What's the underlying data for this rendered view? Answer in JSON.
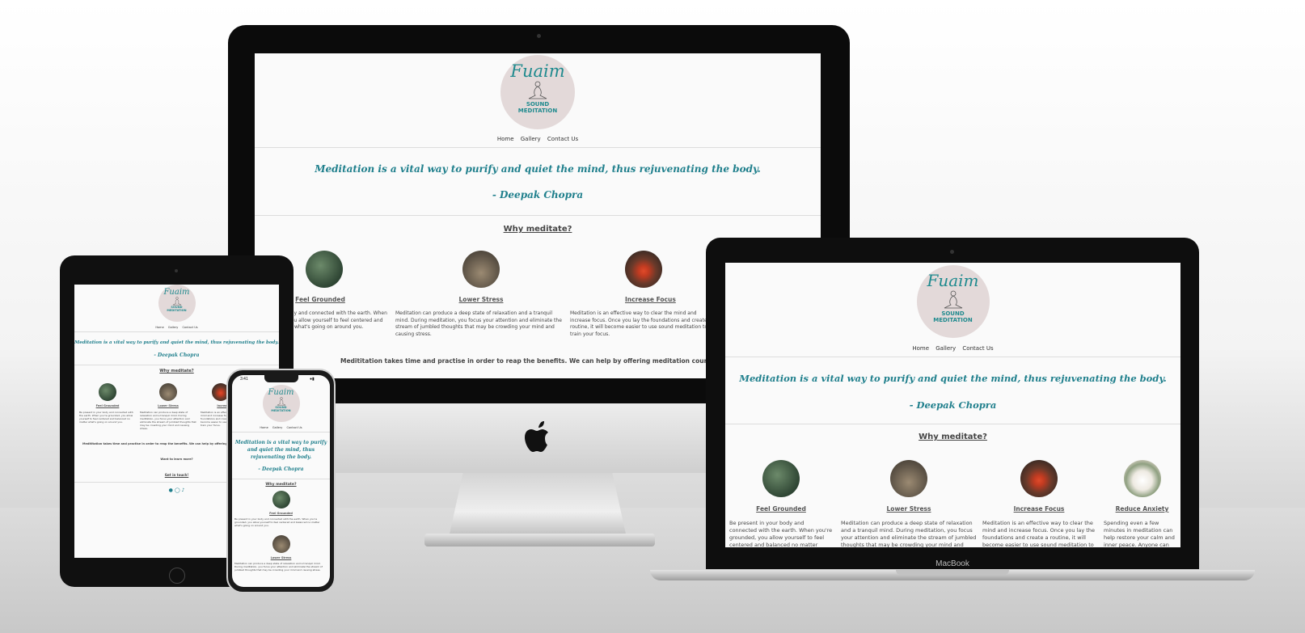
{
  "site": {
    "logo": {
      "script": "Fuaim",
      "line1": "SOUND",
      "line2": "MEDITATION"
    },
    "nav": [
      "Home",
      "Gallery",
      "Contact Us"
    ],
    "quote": "Meditation is a vital way to purify and quiet the mind, thus rejuvenating the body.",
    "author": "- Deepak Chopra",
    "why_heading": "Why meditate?",
    "features": [
      {
        "title": "Feel Grounded",
        "text": "Be present in your body and connected with the earth. When you're grounded, you allow yourself to feel centered and balanced no matter what's going on around you."
      },
      {
        "title": "Lower Stress",
        "text": "Meditation can produce a deep state of relaxation and a tranquil mind. During meditation, you focus your attention and eliminate the stream of jumbled thoughts that may be crowding your mind and causing stress."
      },
      {
        "title": "Increase Focus",
        "text": "Meditation is an effective way to clear the mind and increase focus. Once you lay the foundations and create a routine, it will become easier to use sound meditation to train your focus."
      },
      {
        "title": "Reduce Anxiety",
        "text": "Spending even a few minutes in meditation can help restore your calm and inner peace. Anyone can practice"
      }
    ],
    "benefits_text": "Medititation takes time and practise in order to reap the benefits. We can help by offering meditation courses, retreats and",
    "want_more": "Want to learn more?",
    "get_in_touch": "Get in touch!",
    "social_icons": [
      "facebook-icon",
      "instagram-icon",
      "tiktok-icon"
    ]
  },
  "devices": {
    "macbook_label": "MacBook",
    "phone_time": "3:41",
    "phone_status": "wifi battery"
  },
  "colors": {
    "accent": "#1f8a8e",
    "quote": "#1f7f8c",
    "logo_bg": "#e3d9d9"
  }
}
